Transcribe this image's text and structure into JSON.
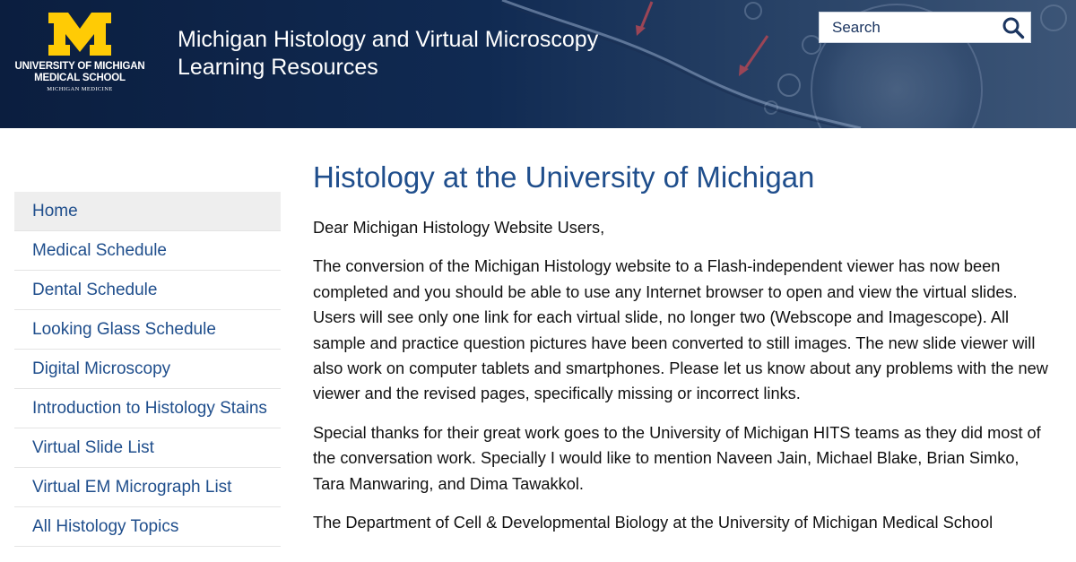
{
  "header": {
    "logo": {
      "line1": "UNIVERSITY OF MICHIGAN",
      "line2": "MEDICAL SCHOOL",
      "line3": "MICHIGAN MEDICINE"
    },
    "title_line1": "Michigan Histology and Virtual Microscopy",
    "title_line2": "Learning Resources",
    "search": {
      "placeholder": "Search",
      "icon": "search-icon"
    },
    "colors": {
      "background": "#0b1e3f",
      "logo_maize": "#ffcb05"
    }
  },
  "sidebar": {
    "items": [
      {
        "label": "Home",
        "active": true
      },
      {
        "label": "Medical Schedule"
      },
      {
        "label": "Dental Schedule"
      },
      {
        "label": "Looking Glass Schedule"
      },
      {
        "label": "Digital Microscopy"
      },
      {
        "label": "Introduction to Histology Stains"
      },
      {
        "label": "Virtual Slide List"
      },
      {
        "label": "Virtual EM Micrograph List"
      },
      {
        "label": "All Histology Topics"
      }
    ]
  },
  "main": {
    "title": "Histology at the University of Michigan",
    "greeting": "Dear Michigan Histology Website Users,",
    "paragraph1": "The conversion of the Michigan Histology website to a Flash-independent viewer has now been completed and you should be able to use any Internet browser to open and view the virtual slides. Users will see only one link for each virtual slide, no longer two (Webscope and Imagescope). All sample and practice question pictures have been converted to still images. The new slide viewer will also work on computer tablets and smartphones. Please let us know about any problems with the new viewer and the revised pages, specifically missing or incorrect links.",
    "paragraph2": "Special thanks for their great work goes to the University of Michigan HITS teams as they did most of the conversation work. Specially I would like to mention Naveen Jain, Michael Blake, Brian Simko, Tara Manwaring, and Dima Tawakkol.",
    "paragraph3": "The Department of Cell & Developmental Biology at the University of Michigan Medical School"
  },
  "colors": {
    "link": "#1f4e8c",
    "active_nav_bg": "#eeeeee",
    "text": "#111111"
  }
}
